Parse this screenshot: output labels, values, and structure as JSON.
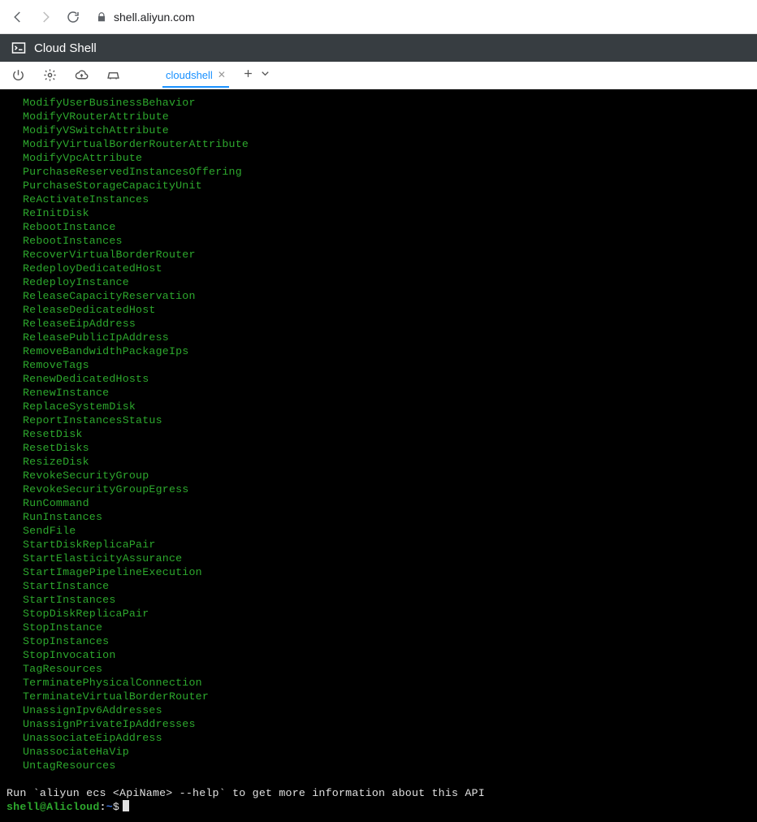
{
  "browser": {
    "url": "shell.aliyun.com"
  },
  "header": {
    "title": "Cloud Shell"
  },
  "tabs": {
    "active": "cloudshell"
  },
  "terminal": {
    "api_list": [
      "ModifyUserBusinessBehavior",
      "ModifyVRouterAttribute",
      "ModifyVSwitchAttribute",
      "ModifyVirtualBorderRouterAttribute",
      "ModifyVpcAttribute",
      "PurchaseReservedInstancesOffering",
      "PurchaseStorageCapacityUnit",
      "ReActivateInstances",
      "ReInitDisk",
      "RebootInstance",
      "RebootInstances",
      "RecoverVirtualBorderRouter",
      "RedeployDedicatedHost",
      "RedeployInstance",
      "ReleaseCapacityReservation",
      "ReleaseDedicatedHost",
      "ReleaseEipAddress",
      "ReleasePublicIpAddress",
      "RemoveBandwidthPackageIps",
      "RemoveTags",
      "RenewDedicatedHosts",
      "RenewInstance",
      "ReplaceSystemDisk",
      "ReportInstancesStatus",
      "ResetDisk",
      "ResetDisks",
      "ResizeDisk",
      "RevokeSecurityGroup",
      "RevokeSecurityGroupEgress",
      "RunCommand",
      "RunInstances",
      "SendFile",
      "StartDiskReplicaPair",
      "StartElasticityAssurance",
      "StartImagePipelineExecution",
      "StartInstance",
      "StartInstances",
      "StopDiskReplicaPair",
      "StopInstance",
      "StopInstances",
      "StopInvocation",
      "TagResources",
      "TerminatePhysicalConnection",
      "TerminateVirtualBorderRouter",
      "UnassignIpv6Addresses",
      "UnassignPrivateIpAddresses",
      "UnassociateEipAddress",
      "UnassociateHaVip",
      "UntagResources"
    ],
    "hint": "Run `aliyun ecs <ApiName> --help` to get more information about this API",
    "prompt_user": "shell@Alicloud",
    "prompt_colon": ":",
    "prompt_path": "~",
    "prompt_dollar": "$"
  }
}
